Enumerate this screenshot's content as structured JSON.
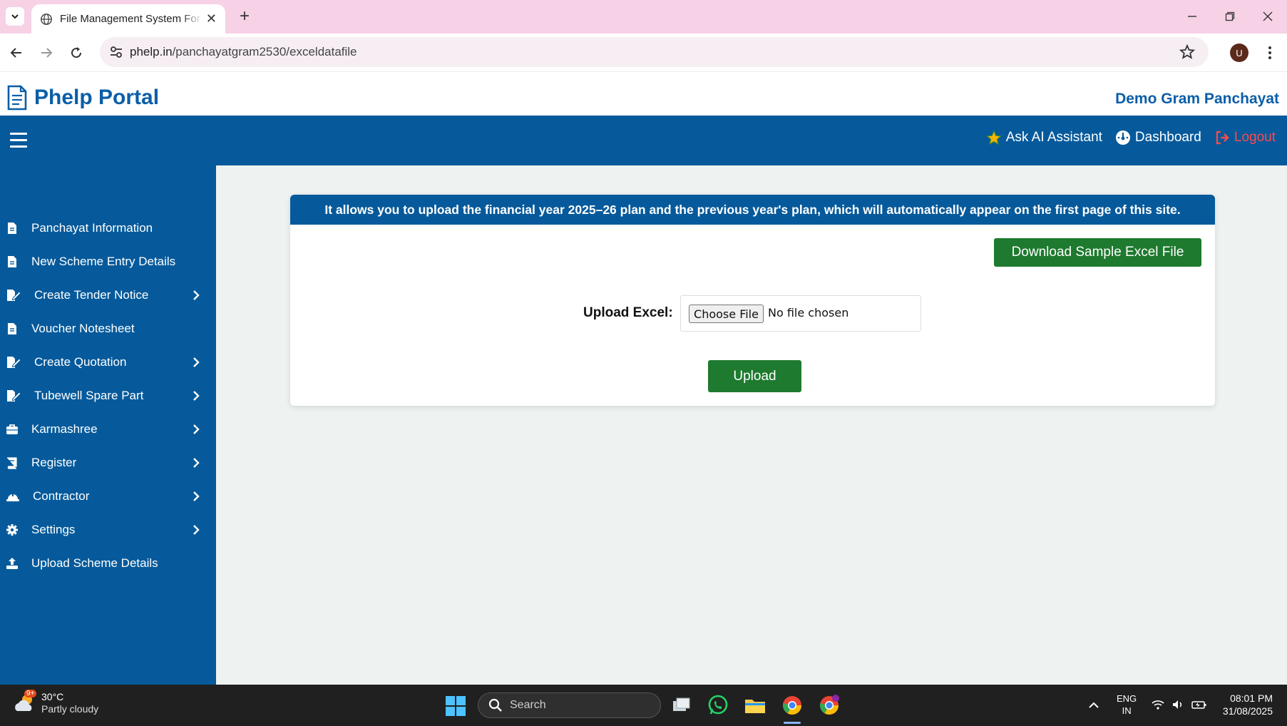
{
  "browser": {
    "tab_title": "File Management System For Gram Panchayat",
    "url_host": "phelp.in",
    "url_path": "/panchayatgram2530/exceldatafile",
    "profile_initial": "U"
  },
  "header": {
    "brand": "Phelp Portal",
    "org_name": "Demo Gram Panchayat"
  },
  "topbar": {
    "ask_ai": "Ask AI Assistant",
    "dashboard": "Dashboard",
    "logout": "Logout"
  },
  "sidebar": {
    "items": [
      {
        "label": "Panchayat Information",
        "icon": "file-icon",
        "has_submenu": false
      },
      {
        "label": "New Scheme Entry Details",
        "icon": "file-icon",
        "has_submenu": false
      },
      {
        "label": "Create Tender Notice",
        "icon": "edit-icon",
        "has_submenu": true
      },
      {
        "label": "Voucher Notesheet",
        "icon": "file-icon",
        "has_submenu": false
      },
      {
        "label": "Create Quotation",
        "icon": "edit-icon",
        "has_submenu": true
      },
      {
        "label": "Tubewell Spare Part",
        "icon": "edit-icon",
        "has_submenu": true
      },
      {
        "label": "Karmashree",
        "icon": "briefcase-icon",
        "has_submenu": true
      },
      {
        "label": "Register",
        "icon": "book-icon",
        "has_submenu": true
      },
      {
        "label": "Contractor",
        "icon": "hardhat-icon",
        "has_submenu": true
      },
      {
        "label": "Settings",
        "icon": "gear-icon",
        "has_submenu": true
      },
      {
        "label": "Upload Scheme Details",
        "icon": "upload-icon",
        "has_submenu": false
      }
    ]
  },
  "main": {
    "banner": "It allows you to upload the financial year 2025–26 plan and the previous year's plan, which will automatically appear on the first page of this site.",
    "download_button": "Download Sample Excel File",
    "upload_label": "Upload Excel:",
    "choose_file": "Choose File",
    "no_file": "No file chosen",
    "upload_button": "Upload"
  },
  "taskbar": {
    "weather_temp": "30°C",
    "weather_desc": "Partly cloudy",
    "weather_badge": "9+",
    "search_placeholder": "Search",
    "lang_top": "ENG",
    "lang_bottom": "IN",
    "time": "08:01 PM",
    "date": "31/08/2025"
  },
  "colors": {
    "brand_blue": "#065a9b",
    "button_green": "#1e7a2e",
    "logout_red": "#ff4a4a",
    "tabbar_pink": "#f7d1e6"
  }
}
